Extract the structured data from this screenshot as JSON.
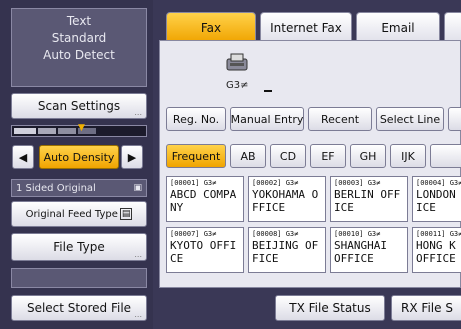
{
  "status": {
    "line1": "Text",
    "line2": "Standard",
    "line3": "Auto Detect"
  },
  "left_buttons": {
    "scan_settings": "Scan Settings",
    "auto_density": "Auto Density",
    "original_sides": "1 Sided Original",
    "original_feed_type": "Original Feed Type",
    "file_type": "File Type",
    "select_stored_file": "Select Stored File"
  },
  "tabs": {
    "fax": "Fax",
    "internet_fax": "Internet Fax",
    "email": "Email"
  },
  "destination": {
    "line_label": "G3≠"
  },
  "actions": {
    "reg_no": "Reg. No.",
    "manual_entry": "Manual Entry",
    "recent": "Recent",
    "select_line": "Select Line"
  },
  "filter_tabs": [
    "Frequent",
    "AB",
    "CD",
    "EF",
    "GH",
    "IJK"
  ],
  "destinations": [
    {
      "code": "[00001] G3≠",
      "name": "ABCD COMPA\nNY"
    },
    {
      "code": "[00002] G3≠",
      "name": "YOKOHAMA O\nFFICE"
    },
    {
      "code": "[00003] G3≠",
      "name": "BERLIN OFF\nICE"
    },
    {
      "code": "[00004] G3≠",
      "name": "LONDON\nICE"
    },
    {
      "code": "[00007] G3≠",
      "name": "KYOTO OFFI\nCE"
    },
    {
      "code": "[00008] G3≠",
      "name": "BEIJING OF\nFICE"
    },
    {
      "code": "[00010] G3≠",
      "name": "SHANGHAI\nOFFICE"
    },
    {
      "code": "[00011] G3≠",
      "name": "HONG K\nOFFICE"
    }
  ],
  "bottom": {
    "tx_file_status": "TX File Status",
    "rx_file_status": "RX File S"
  },
  "colors": {
    "accent": "#f0a400",
    "panel_bg": "#e8e8f0",
    "screen_bg": "#35334f"
  }
}
